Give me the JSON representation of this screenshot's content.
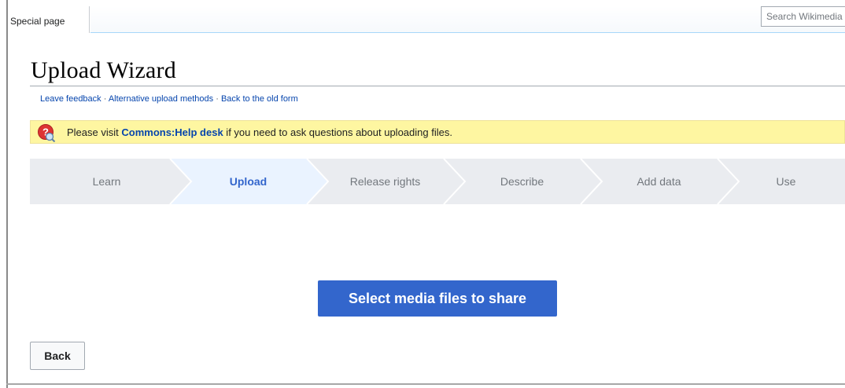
{
  "tabs": {
    "special_page": "Special page"
  },
  "search": {
    "placeholder": "Search Wikimedia Commons"
  },
  "page": {
    "title": "Upload Wizard"
  },
  "links": {
    "leave_feedback": "Leave feedback",
    "alternative_methods": "Alternative upload methods",
    "old_form": "Back to the old form",
    "separator": " · "
  },
  "notice": {
    "prefix": "Please visit ",
    "link": "Commons:Help desk",
    "suffix": " if you need to ask questions about uploading files.",
    "icon": "help-question-icon"
  },
  "steps": {
    "items": [
      {
        "label": "Learn",
        "active": false
      },
      {
        "label": "Upload",
        "active": true
      },
      {
        "label": "Release rights",
        "active": false
      },
      {
        "label": "Describe",
        "active": false
      },
      {
        "label": "Add data",
        "active": false
      },
      {
        "label": "Use",
        "active": false
      }
    ]
  },
  "buttons": {
    "select_media": "Select media files to share",
    "back": "Back"
  },
  "colors": {
    "accent": "#3366cc",
    "step_bg": "#eaecf0",
    "step_active_bg": "#eaf3ff",
    "notice_bg": "#fef6a1",
    "link": "#0645ad"
  }
}
